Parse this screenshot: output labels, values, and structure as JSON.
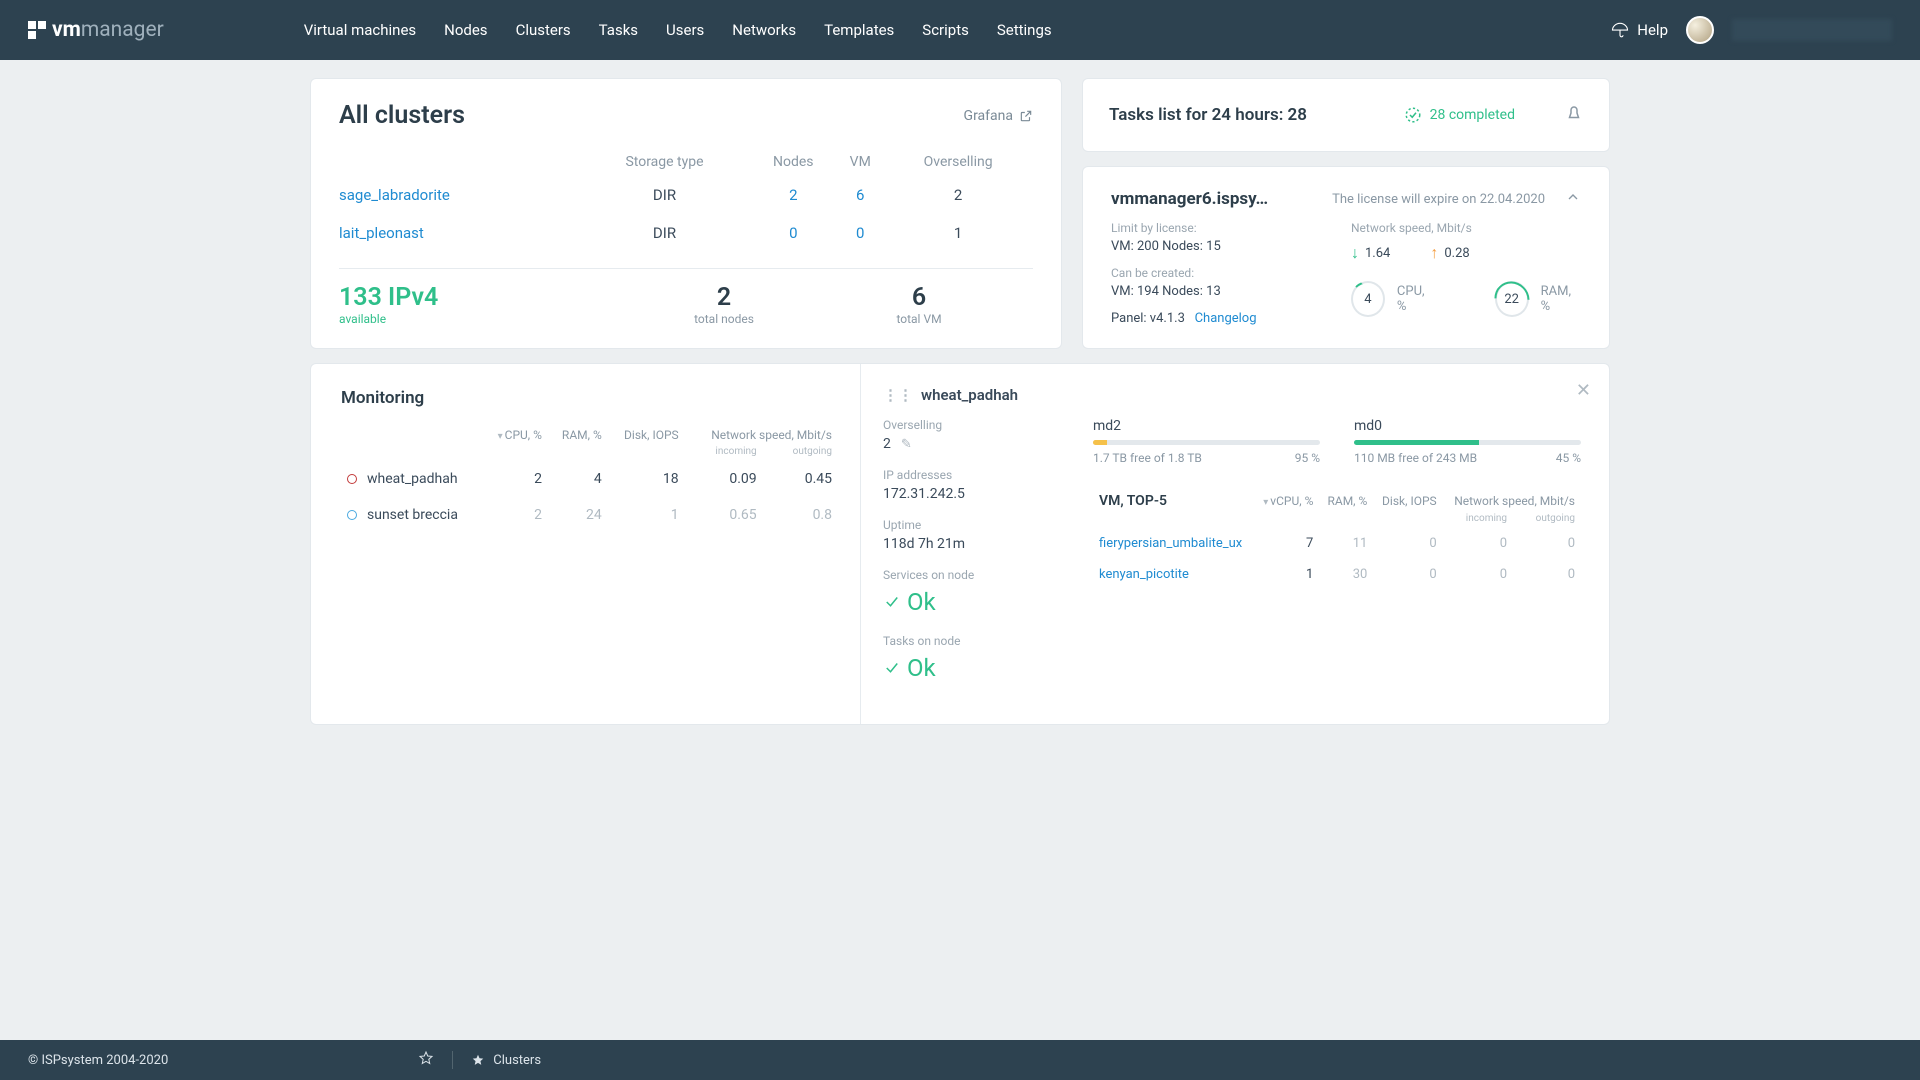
{
  "nav": {
    "items": [
      "Virtual machines",
      "Nodes",
      "Clusters",
      "Tasks",
      "Users",
      "Networks",
      "Templates",
      "Scripts",
      "Settings"
    ],
    "help": "Help"
  },
  "logo": {
    "vm": "vm",
    "mgr": "manager"
  },
  "clusters": {
    "title": "All clusters",
    "grafana": "Grafana",
    "cols": [
      "",
      "Storage type",
      "Nodes",
      "VM",
      "Overselling"
    ],
    "rows": [
      {
        "name": "sage_labradorite",
        "storage": "DIR",
        "nodes": "2",
        "vm": "6",
        "over": "2"
      },
      {
        "name": "lait_pleonast",
        "storage": "DIR",
        "nodes": "0",
        "vm": "0",
        "over": "1"
      }
    ],
    "ip": {
      "big": "133 IPv4",
      "sub": "available"
    },
    "totalNodes": {
      "big": "2",
      "sub": "total nodes"
    },
    "totalVM": {
      "big": "6",
      "sub": "total VM"
    }
  },
  "tasks": {
    "title": "Tasks list for 24 hours: 28",
    "completed": "28 completed"
  },
  "license": {
    "host": "vmmanager6.ispsy…",
    "expire": "The license will expire on 22.04.2020",
    "limitLabel": "Limit by license:",
    "limit": "VM: 200   Nodes: 15",
    "canLabel": "Can be created:",
    "can": "VM: 194   Nodes: 13",
    "panelLabel": "Panel: v4.1.3",
    "changelog": "Changelog",
    "speedLabel": "Network speed, Mbit/s",
    "down": "1.64",
    "up": "0.28",
    "cpu": "4",
    "cpuLab": "CPU, %",
    "ram": "22",
    "ramLab": "RAM, %"
  },
  "monitoring": {
    "title": "Monitoring",
    "cols": {
      "cpu": "CPU, %",
      "ram": "RAM, %",
      "disk": "Disk, IOPS",
      "net": "Network speed, Mbit/s",
      "in": "incoming",
      "out": "outgoing"
    },
    "rows": [
      {
        "name": "wheat_padhah",
        "cpu": "2",
        "ram": "4",
        "disk": "18",
        "in": "0.09",
        "out": "0.45",
        "dim": false,
        "dot": "red"
      },
      {
        "name": "sunset  breccia",
        "cpu": "2",
        "ram": "24",
        "disk": "1",
        "in": "0.65",
        "out": "0.8",
        "dim": true,
        "dot": "blue"
      }
    ]
  },
  "detail": {
    "name": "wheat_padhah",
    "over": {
      "lbl": "Overselling",
      "v": "2"
    },
    "ip": {
      "lbl": "IP addresses",
      "v": "172.31.242.5"
    },
    "uptime": {
      "lbl": "Uptime",
      "v": "118d 7h 21m"
    },
    "services": {
      "lbl": "Services on node",
      "v": "Ok"
    },
    "tasksn": {
      "lbl": "Tasks on node",
      "v": "Ok"
    },
    "disks": [
      {
        "name": "md2",
        "free": "1.7 TB free of 1.8 TB",
        "pct": "95 %",
        "fill": 6,
        "warn": true
      },
      {
        "name": "md0",
        "free": "110 MB free of 243 MB",
        "pct": "45 %",
        "fill": 55,
        "warn": false
      }
    ],
    "top5": {
      "head": "VM, TOP-5",
      "cols": {
        "vcpu": "vCPU, %",
        "ram": "RAM, %",
        "disk": "Disk, IOPS",
        "net": "Network speed, Mbit/s",
        "in": "incoming",
        "out": "outgoing"
      },
      "rows": [
        {
          "name": "fierypersian_umbalite_ux",
          "vcpu": "7",
          "ram": "11",
          "disk": "0",
          "in": "0",
          "out": "0"
        },
        {
          "name": "kenyan_picotite",
          "vcpu": "1",
          "ram": "30",
          "disk": "0",
          "in": "0",
          "out": "0"
        }
      ]
    }
  },
  "footer": {
    "copyright": "© ISPsystem 2004-2020",
    "crumb": "Clusters"
  }
}
